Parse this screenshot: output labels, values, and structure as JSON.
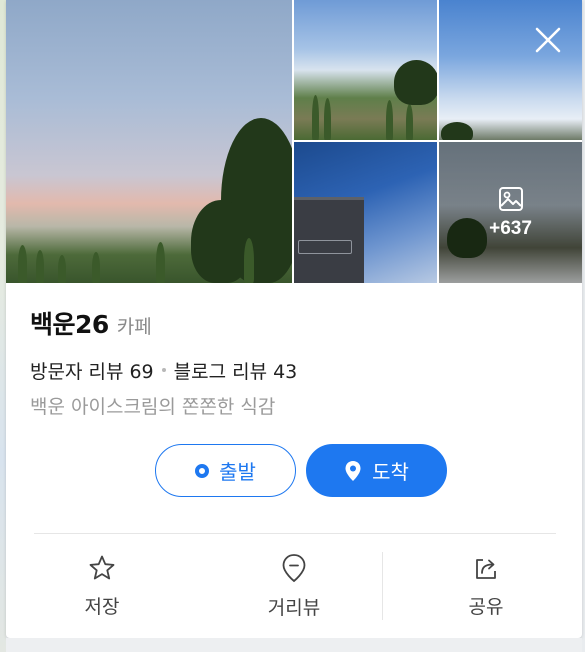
{
  "gallery": {
    "more_count": "+637"
  },
  "place": {
    "name": "백운26",
    "category": "카페",
    "visitor_review_label": "방문자 리뷰",
    "visitor_review_count": "69",
    "blog_review_label": "블로그 리뷰",
    "blog_review_count": "43",
    "description": "백운 아이스크림의 쫀쫀한 식감"
  },
  "route": {
    "depart_label": "출발",
    "arrive_label": "도착"
  },
  "actions": {
    "save_label": "저장",
    "streetview_label": "거리뷰",
    "share_label": "공유"
  },
  "colors": {
    "accent": "#1e78f0",
    "text_primary": "#111111",
    "text_secondary": "#9a9a9a"
  }
}
